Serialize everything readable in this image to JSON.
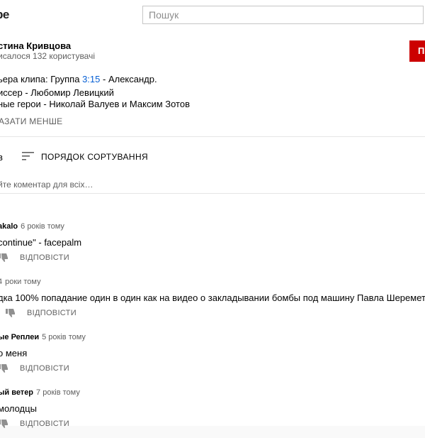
{
  "header": {
    "logo_text": "be",
    "search_placeholder": "Пошук"
  },
  "channel": {
    "name": "стина Кривцова",
    "subscribers": "исалося 132 користувачі",
    "subscribe_label": "П",
    "subscribe_color": "#cc0000"
  },
  "description": {
    "line1_prefix": "ьера клипа: Группа ",
    "line1_timestamp": "3:15",
    "line1_suffix": " - Александр.",
    "line2": "иссер - Любомир Левицкий",
    "line3": "ные герои - Николай Валуев и Максим Зотов",
    "show_less": "АЗАТИ МЕНШЕ"
  },
  "comments_header": {
    "count": "в",
    "sort_label": "ПОРЯДОК СОРТУВАННЯ",
    "add_comment_placeholder": "йте коментар для всіх…"
  },
  "comments": [
    {
      "author": "akalo",
      "time": "6 років тому",
      "text": "continue\" - facepalm",
      "reply": "ВІДПОВІСТИ"
    },
    {
      "author": "4",
      "time": "роки тому",
      "text": "дка 100% попадание один в один как  на видео о закладывании бомбы под машину Павла Шеремета.",
      "reply": "ВІДПОВІСТИ"
    },
    {
      "author": "ые Реплеи",
      "time": "5 років тому",
      "text": "о меня",
      "reply": "ВІДПОВІСТИ"
    },
    {
      "author": "ый ветер",
      "time": "7 років тому",
      "text": "молодцы",
      "reply": "ВІДПОВІСТИ"
    }
  ],
  "icons": {
    "sort": "sort-icon",
    "dislike": "thumbs-down-icon"
  }
}
